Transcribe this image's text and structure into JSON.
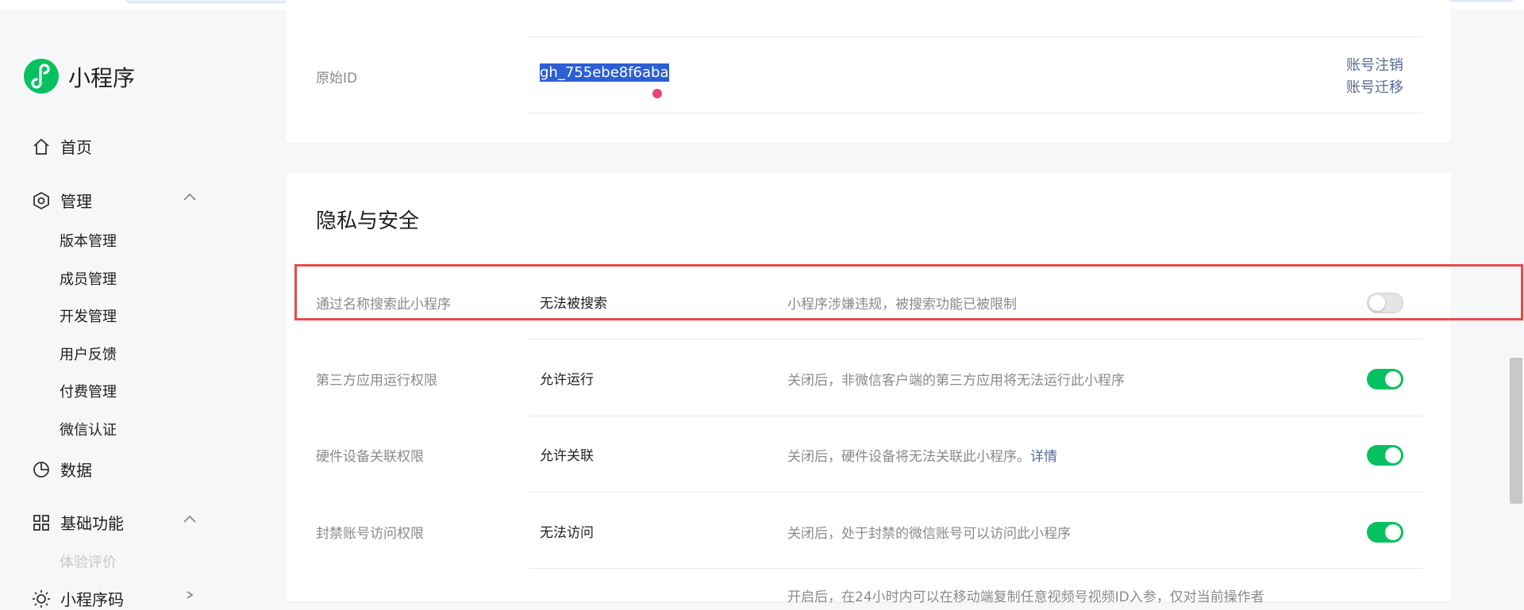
{
  "sidebar": {
    "brand": "小程序",
    "home": "首页",
    "manage": "管理",
    "manage_items": [
      "版本管理",
      "成员管理",
      "开发管理",
      "用户反馈",
      "付费管理",
      "微信认证"
    ],
    "data": "数据",
    "basic": "基础功能",
    "basic_faded": "体验评价",
    "qrcode": "小程序码"
  },
  "account": {
    "label": "原始ID",
    "value": "gh_755ebe8f6aba",
    "cancel_link": "账号注销",
    "migrate_link": "账号迁移"
  },
  "privacy": {
    "title": "隐私与安全",
    "rows": [
      {
        "label": "通过名称搜索此小程序",
        "value": "无法被搜索",
        "desc": "小程序涉嫌违规，被搜索功能已被限制",
        "toggle": "off"
      },
      {
        "label": "第三方应用运行权限",
        "value": "允许运行",
        "desc": "关闭后，非微信客户端的第三方应用将无法运行此小程序",
        "toggle": "on"
      },
      {
        "label": "硬件设备关联权限",
        "value": "允许关联",
        "desc": "关闭后，硬件设备将无法关联此小程序。",
        "desc_link": "详情",
        "toggle": "on"
      },
      {
        "label": "封禁账号访问权限",
        "value": "无法访问",
        "desc": "关闭后，处于封禁的微信账号可以访问此小程序",
        "toggle": "on"
      }
    ],
    "partial_desc": "开启后，在24小时内可以在移动端复制任意视频号视频ID入参，仅对当前操作者"
  },
  "colors": {
    "accent": "#07c160",
    "link": "#576b95",
    "highlight": "#e8494b"
  }
}
